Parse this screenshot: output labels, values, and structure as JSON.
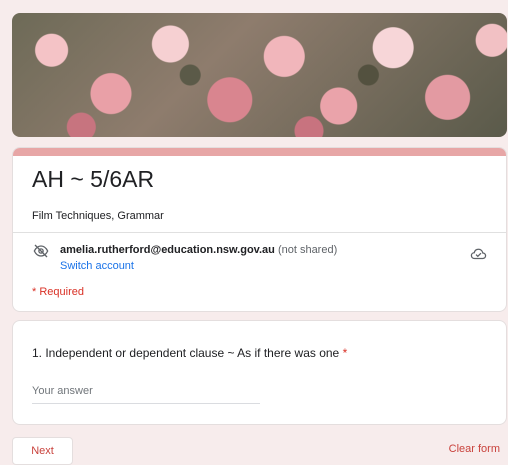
{
  "form": {
    "title": "AH ~ 5/6AR",
    "description": "Film Techniques, Grammar",
    "accent_color": "#e7a6a6"
  },
  "account": {
    "email": "amelia.rutherford@education.nsw.gov.au",
    "note": "(not shared)",
    "switch_label": "Switch account",
    "privacy_icon": "eye-off-icon",
    "save_icon": "cloud-check-icon"
  },
  "required_note": "* Required",
  "question": {
    "text": "1. Independent or dependent clause ~ As if there was one",
    "required_marker": "*",
    "answer_placeholder": "Your answer",
    "answer_value": ""
  },
  "footer": {
    "next_label": "Next",
    "clear_label": "Clear form"
  },
  "colors": {
    "link": "#1a73e8",
    "required": "#d93025",
    "button_text": "#c9423c"
  }
}
